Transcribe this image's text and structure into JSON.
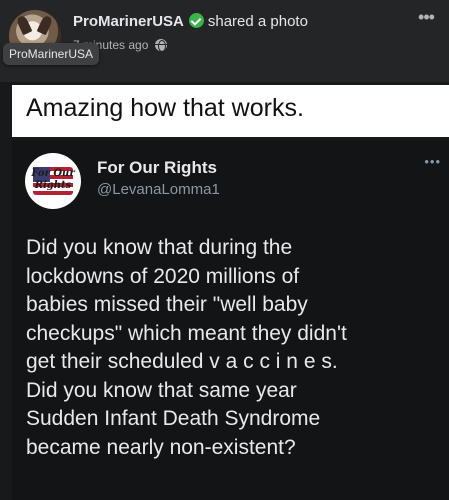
{
  "post": {
    "author": "ProMarinerUSA",
    "action": "shared a photo",
    "timestamp": "7 minutes ago",
    "hover_label": "ProMarinerUSA",
    "more_icon": "more-options-icon",
    "verified_icon": "verified-badge-icon",
    "privacy_icon": "globe-icon"
  },
  "shared_image": {
    "caption": "Amazing how that works.",
    "tweet": {
      "name": "For Our Rights",
      "handle": "@LevanaLomma1",
      "avatar_text": "For Our Rights",
      "body_lines": [
        "Did you know that during the",
        "lockdowns of 2020 millions of",
        "babies missed their \"well baby",
        "checkups\" which meant they didn't",
        "get their scheduled v a c c i n e s.",
        "Did you know that same year",
        "Sudden Infant Death Syndrome",
        "became nearly non-existent?"
      ]
    }
  },
  "colors": {
    "page_bg": "#18191a",
    "header_bg": "#242526",
    "verified_green": "#3bb34a",
    "tweet_bg": "#121416",
    "tweet_text": "#e7e9ea",
    "handle_gray": "#8b98a5"
  }
}
